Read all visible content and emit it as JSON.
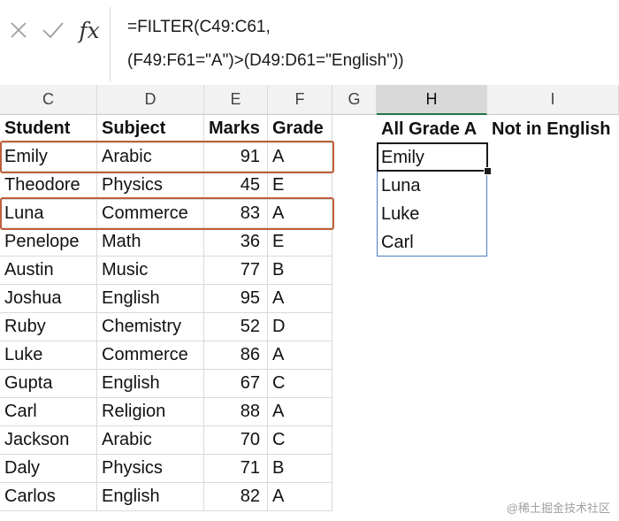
{
  "formula_bar": {
    "cancel_icon": "x-icon",
    "enter_icon": "check-icon",
    "fx_label": "fx",
    "formula_line1": "=FILTER(C49:C61,",
    "formula_line2": "(F49:F61=\"A\")>(D49:D61=\"English\"))"
  },
  "columns": [
    "C",
    "D",
    "E",
    "F",
    "G",
    "H",
    "I"
  ],
  "selected_column": "H",
  "headers": {
    "student": "Student",
    "subject": "Subject",
    "marks": "Marks",
    "grade": "Grade",
    "all_grade_a": "All Grade A",
    "not_in_english": "Not in English"
  },
  "rows": [
    {
      "student": "Emily",
      "subject": "Arabic",
      "marks": "91",
      "grade": "A"
    },
    {
      "student": "Theodore",
      "subject": "Physics",
      "marks": "45",
      "grade": "E"
    },
    {
      "student": "Luna",
      "subject": "Commerce",
      "marks": "83",
      "grade": "A"
    },
    {
      "student": "Penelope",
      "subject": "Math",
      "marks": "36",
      "grade": "E"
    },
    {
      "student": "Austin",
      "subject": "Music",
      "marks": "77",
      "grade": "B"
    },
    {
      "student": "Joshua",
      "subject": "English",
      "marks": "95",
      "grade": "A"
    },
    {
      "student": "Ruby",
      "subject": "Chemistry",
      "marks": "52",
      "grade": "D"
    },
    {
      "student": "Luke",
      "subject": "Commerce",
      "marks": "86",
      "grade": "A"
    },
    {
      "student": "Gupta",
      "subject": "English",
      "marks": "67",
      "grade": "C"
    },
    {
      "student": "Carl",
      "subject": "Religion",
      "marks": "88",
      "grade": "A"
    },
    {
      "student": "Jackson",
      "subject": "Arabic",
      "marks": "70",
      "grade": "C"
    },
    {
      "student": "Daly",
      "subject": "Physics",
      "marks": "71",
      "grade": "B"
    },
    {
      "student": "Carlos",
      "subject": "English",
      "marks": "82",
      "grade": "A"
    }
  ],
  "results": [
    "Emily",
    "Luna",
    "Luke",
    "Carl"
  ],
  "highlighted_rows": [
    "Emily",
    "Luna"
  ],
  "highlight_color": "#c0603a",
  "spill_border_color": "#4a7ec2",
  "watermark": "@稀土掘金技术社区"
}
